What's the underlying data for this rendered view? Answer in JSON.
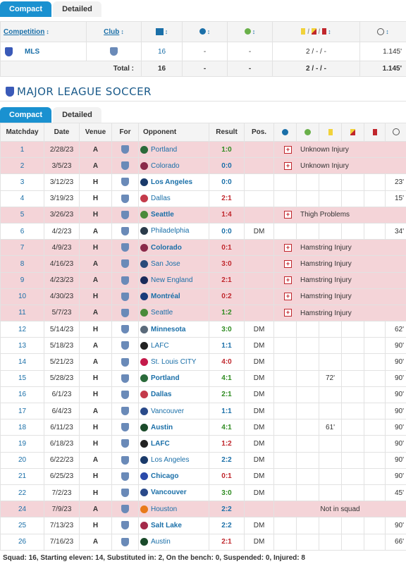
{
  "top_tabs": {
    "compact": "Compact",
    "detailed": "Detailed"
  },
  "summary": {
    "headers": {
      "competition": "Competition",
      "club": "Club"
    },
    "row": {
      "competition": "MLS",
      "appearances": "16",
      "goals": "-",
      "assists": "-",
      "cards": "2 / - / -",
      "minutes": "1.145'"
    },
    "total": {
      "label": "Total :",
      "appearances": "16",
      "goals": "-",
      "assists": "-",
      "cards": "2 / - / -",
      "minutes": "1.145'"
    }
  },
  "section_title": "MAJOR LEAGUE SOCCER",
  "main_tabs": {
    "compact": "Compact",
    "detailed": "Detailed"
  },
  "columns": {
    "matchday": "Matchday",
    "date": "Date",
    "venue": "Venue",
    "for": "For",
    "opponent": "Opponent",
    "result": "Result",
    "pos": "Pos."
  },
  "matches": [
    {
      "md": "1",
      "date": "2/28/23",
      "venue": "A",
      "opp": "Portland",
      "bold": false,
      "res": "1:0",
      "rc": "w",
      "note": "Unknown Injury",
      "inj": true,
      "oc": "#2a6a3a"
    },
    {
      "md": "2",
      "date": "3/5/23",
      "venue": "A",
      "opp": "Colorado",
      "bold": false,
      "res": "0:0",
      "rc": "d",
      "note": "Unknown Injury",
      "inj": true,
      "oc": "#8a2a4a"
    },
    {
      "md": "3",
      "date": "3/12/23",
      "venue": "H",
      "opp": "Los Angeles",
      "bold": true,
      "res": "0:0",
      "rc": "d",
      "min": "23'",
      "oc": "#1a3a6a"
    },
    {
      "md": "4",
      "date": "3/19/23",
      "venue": "H",
      "opp": "Dallas",
      "bold": false,
      "res": "2:1",
      "rc": "l",
      "min": "15'",
      "oc": "#c43a4a"
    },
    {
      "md": "5",
      "date": "3/26/23",
      "venue": "H",
      "opp": "Seattle",
      "bold": true,
      "res": "1:4",
      "rc": "l",
      "note": "Thigh Problems",
      "inj": true,
      "oc": "#4a8a3a"
    },
    {
      "md": "6",
      "date": "4/2/23",
      "venue": "A",
      "opp": "Philadelphia",
      "bold": false,
      "res": "0:0",
      "rc": "d",
      "pos": "DM",
      "min": "34'",
      "oc": "#2a3a4a"
    },
    {
      "md": "7",
      "date": "4/9/23",
      "venue": "H",
      "opp": "Colorado",
      "bold": true,
      "res": "0:1",
      "rc": "l",
      "note": "Hamstring Injury",
      "inj": true,
      "oc": "#8a2a4a"
    },
    {
      "md": "8",
      "date": "4/16/23",
      "venue": "A",
      "opp": "San Jose",
      "bold": false,
      "res": "3:0",
      "rc": "l",
      "note": "Hamstring Injury",
      "inj": true,
      "oc": "#2a4a7a"
    },
    {
      "md": "9",
      "date": "4/23/23",
      "venue": "A",
      "opp": "New England",
      "bold": false,
      "res": "2:1",
      "rc": "l",
      "note": "Hamstring Injury",
      "inj": true,
      "oc": "#1a2a5a"
    },
    {
      "md": "10",
      "date": "4/30/23",
      "venue": "H",
      "opp": "Montréal",
      "bold": true,
      "res": "0:2",
      "rc": "l",
      "note": "Hamstring Injury",
      "inj": true,
      "oc": "#1a3a7a"
    },
    {
      "md": "11",
      "date": "5/7/23",
      "venue": "A",
      "opp": "Seattle",
      "bold": false,
      "res": "1:2",
      "rc": "w",
      "note": "Hamstring Injury",
      "inj": true,
      "oc": "#4a8a3a"
    },
    {
      "md": "12",
      "date": "5/14/23",
      "venue": "H",
      "opp": "Minnesota",
      "bold": true,
      "res": "3:0",
      "rc": "w",
      "pos": "DM",
      "min": "62'",
      "oc": "#5a6a7a"
    },
    {
      "md": "13",
      "date": "5/18/23",
      "venue": "A",
      "opp": "LAFC",
      "bold": false,
      "res": "1:1",
      "rc": "d",
      "pos": "DM",
      "min": "90'",
      "oc": "#222222"
    },
    {
      "md": "14",
      "date": "5/21/23",
      "venue": "A",
      "opp": "St. Louis CITY",
      "bold": false,
      "res": "4:0",
      "rc": "l",
      "pos": "DM",
      "min": "90'",
      "oc": "#c41a4a"
    },
    {
      "md": "15",
      "date": "5/28/23",
      "venue": "H",
      "opp": "Portland",
      "bold": true,
      "res": "4:1",
      "rc": "w",
      "pos": "DM",
      "yel": "72'",
      "min": "90'",
      "oc": "#2a6a3a"
    },
    {
      "md": "16",
      "date": "6/1/23",
      "venue": "H",
      "opp": "Dallas",
      "bold": true,
      "res": "2:1",
      "rc": "w",
      "pos": "DM",
      "min": "90'",
      "oc": "#c43a4a"
    },
    {
      "md": "17",
      "date": "6/4/23",
      "venue": "A",
      "opp": "Vancouver",
      "bold": false,
      "res": "1:1",
      "rc": "d",
      "pos": "DM",
      "min": "90'",
      "oc": "#2a4a8a"
    },
    {
      "md": "18",
      "date": "6/11/23",
      "venue": "H",
      "opp": "Austin",
      "bold": true,
      "res": "4:1",
      "rc": "w",
      "pos": "DM",
      "yel": "61'",
      "min": "90'",
      "oc": "#1a4a2a"
    },
    {
      "md": "19",
      "date": "6/18/23",
      "venue": "H",
      "opp": "LAFC",
      "bold": true,
      "res": "1:2",
      "rc": "l",
      "pos": "DM",
      "min": "90'",
      "oc": "#222222"
    },
    {
      "md": "20",
      "date": "6/22/23",
      "venue": "A",
      "opp": "Los Angeles",
      "bold": false,
      "res": "2:2",
      "rc": "d",
      "pos": "DM",
      "min": "90'",
      "oc": "#1a3a6a"
    },
    {
      "md": "21",
      "date": "6/25/23",
      "venue": "H",
      "opp": "Chicago",
      "bold": true,
      "res": "0:1",
      "rc": "l",
      "pos": "DM",
      "min": "90'",
      "oc": "#2a4aaa"
    },
    {
      "md": "22",
      "date": "7/2/23",
      "venue": "H",
      "opp": "Vancouver",
      "bold": true,
      "res": "3:0",
      "rc": "w",
      "pos": "DM",
      "min": "45'",
      "oc": "#2a4a8a"
    },
    {
      "md": "24",
      "date": "7/9/23",
      "venue": "A",
      "opp": "Houston",
      "bold": false,
      "res": "2:2",
      "rc": "d",
      "note": "Not in squad",
      "inj": true,
      "squad": true,
      "oc": "#e87a1a"
    },
    {
      "md": "25",
      "date": "7/13/23",
      "venue": "H",
      "opp": "Salt Lake",
      "bold": true,
      "res": "2:2",
      "rc": "d",
      "pos": "DM",
      "min": "90'",
      "oc": "#a42a4a"
    },
    {
      "md": "26",
      "date": "7/16/23",
      "venue": "A",
      "opp": "Austin",
      "bold": false,
      "res": "2:1",
      "rc": "l",
      "pos": "DM",
      "min": "66'",
      "oc": "#1a4a2a"
    }
  ],
  "footer": "Squad: 16, Starting eleven: 14, Substituted in: 2, On the bench: 0, Suspended: 0, Injured: 8"
}
